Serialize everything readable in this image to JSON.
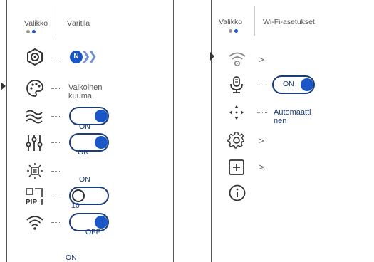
{
  "left": {
    "tabs": [
      {
        "label": "Valikko"
      },
      {
        "label": "Väritila"
      }
    ],
    "items": [
      {
        "icon": "target-hexagon-icon",
        "badge": "N",
        "badge_arrows": "❯❯"
      },
      {
        "icon": "palette-icon",
        "text": "Valkoinen kuuma"
      },
      {
        "icon": "wave-icon",
        "toggle_label": "ON"
      },
      {
        "icon": "sliders-icon",
        "toggle_label": "ON"
      },
      {
        "icon": "brightness-icon",
        "value": "ON"
      },
      {
        "icon": "pip-icon",
        "toggle_label": "10"
      },
      {
        "icon": "wifi-icon",
        "toggle_label": "OFF"
      }
    ],
    "footer_value": "ON",
    "colors": {
      "accent": "#1a56c8",
      "border": "#1a3c7a"
    }
  },
  "right": {
    "tabs": [
      {
        "label": "Valikko"
      },
      {
        "label": "Wi-Fi-asetukset"
      }
    ],
    "items": [
      {
        "icon": "wifi-settings-icon"
      },
      {
        "icon": "microphone-icon",
        "toggle_label": "ON"
      },
      {
        "icon": "focus-icon",
        "text": "Automaatti nen"
      },
      {
        "icon": "gear-icon"
      },
      {
        "icon": "plus-box-icon"
      },
      {
        "icon": "info-icon"
      }
    ]
  }
}
